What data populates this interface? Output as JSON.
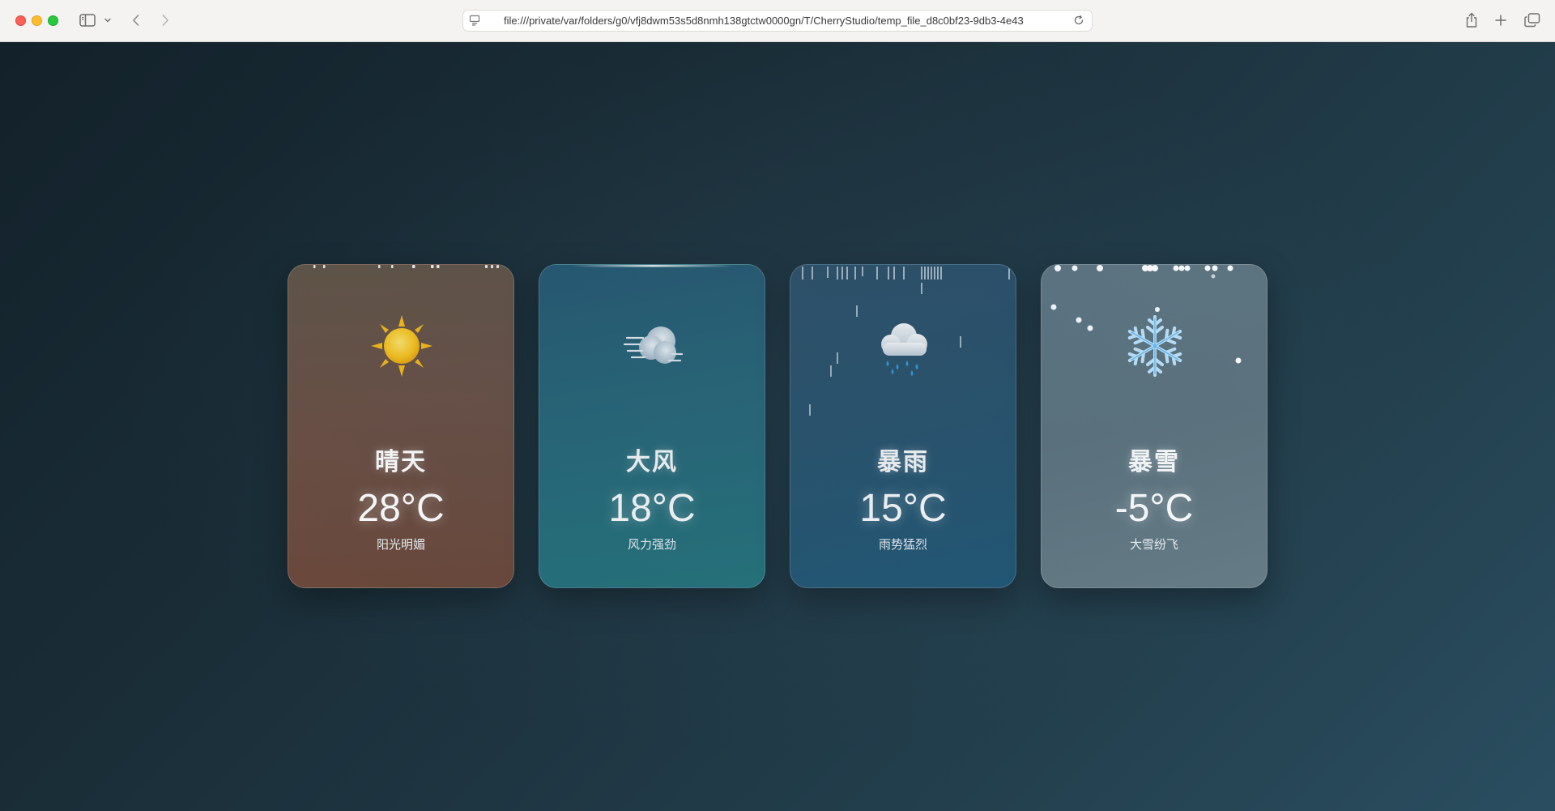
{
  "browser": {
    "address_url": "file:///private/var/folders/g0/vfj8dwm53s5d8nmh138gtctw0000gn/T/CherryStudio/temp_file_d8c0bf23-9db3-4e43",
    "icons": [
      "sidebar-icon",
      "chevron-down-icon",
      "back-icon",
      "forward-icon",
      "page-icon",
      "reload-icon",
      "share-icon",
      "new-tab-icon",
      "tab-overview-icon"
    ]
  },
  "cards": [
    {
      "id": "sunny",
      "icon": "sun-icon",
      "title": "晴天",
      "temp": "28°C",
      "desc": "阳光明媚",
      "color": "#6a4e43"
    },
    {
      "id": "windy",
      "icon": "wind-icon",
      "title": "大风",
      "temp": "18°C",
      "desc": "风力强劲",
      "color": "#246677"
    },
    {
      "id": "rain",
      "icon": "rain-cloud-icon",
      "title": "暴雨",
      "temp": "15°C",
      "desc": "雨势猛烈",
      "color": "#26506b"
    },
    {
      "id": "snow",
      "icon": "snowflake-icon",
      "title": "暴雪",
      "temp": "-5°C",
      "desc": "大雪纷飞",
      "color": "#5d737e"
    }
  ]
}
